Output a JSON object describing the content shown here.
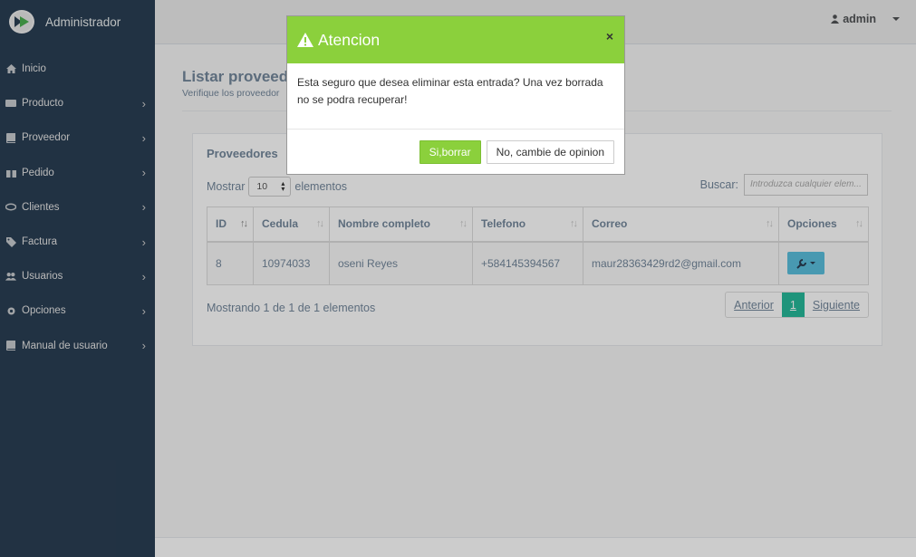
{
  "sidebar": {
    "brand": "Administrador",
    "items": [
      {
        "label": "Inicio",
        "icon": "home-icon",
        "chevron": false
      },
      {
        "label": "Producto",
        "icon": "truck-icon",
        "chevron": true
      },
      {
        "label": "Proveedor",
        "icon": "book-icon",
        "chevron": true
      },
      {
        "label": "Pedido",
        "icon": "gift-icon",
        "chevron": true
      },
      {
        "label": "Clientes",
        "icon": "handshake-icon",
        "chevron": true
      },
      {
        "label": "Factura",
        "icon": "tag-icon",
        "chevron": true
      },
      {
        "label": "Usuarios",
        "icon": "users-icon",
        "chevron": true
      },
      {
        "label": "Opciones",
        "icon": "gear-icon",
        "chevron": true
      },
      {
        "label": "Manual de usuario",
        "icon": "book-icon",
        "chevron": true
      }
    ]
  },
  "topnav": {
    "user": "admin"
  },
  "page": {
    "title": "Listar proveedo",
    "subtitle": "Verifique los proveedor"
  },
  "panel": {
    "title": "Proveedores",
    "show_prefix": "Mostrar",
    "show_value": "10",
    "show_suffix": "elementos",
    "search_label": "Buscar:",
    "search_placeholder": "Introduzca cualquier elem...",
    "columns": [
      "ID",
      "Cedula",
      "Nombre completo",
      "Telefono",
      "Correo",
      "Opciones"
    ],
    "rows": [
      {
        "id": "8",
        "cedula": "10974033",
        "nombre": "oseni Reyes",
        "telefono": "+584145394567",
        "correo": "maur28363429rd2@gmail.com"
      }
    ],
    "info": "Mostrando 1 de 1 de 1 elementos",
    "pager": {
      "prev": "Anterior",
      "current": "1",
      "next": "Siguiente"
    }
  },
  "modal": {
    "title": "Atencion",
    "close": "×",
    "body": "Esta seguro que desea eliminar esta entrada? Una vez borrada no se podra recuperar!",
    "confirm": "Si,borrar",
    "cancel": "No, cambie de opinion"
  },
  "colors": {
    "sidebar": "#2a3f54",
    "modal_header": "#8bd03c",
    "pager_current": "#26b99a",
    "info_button": "#5bc0de"
  }
}
